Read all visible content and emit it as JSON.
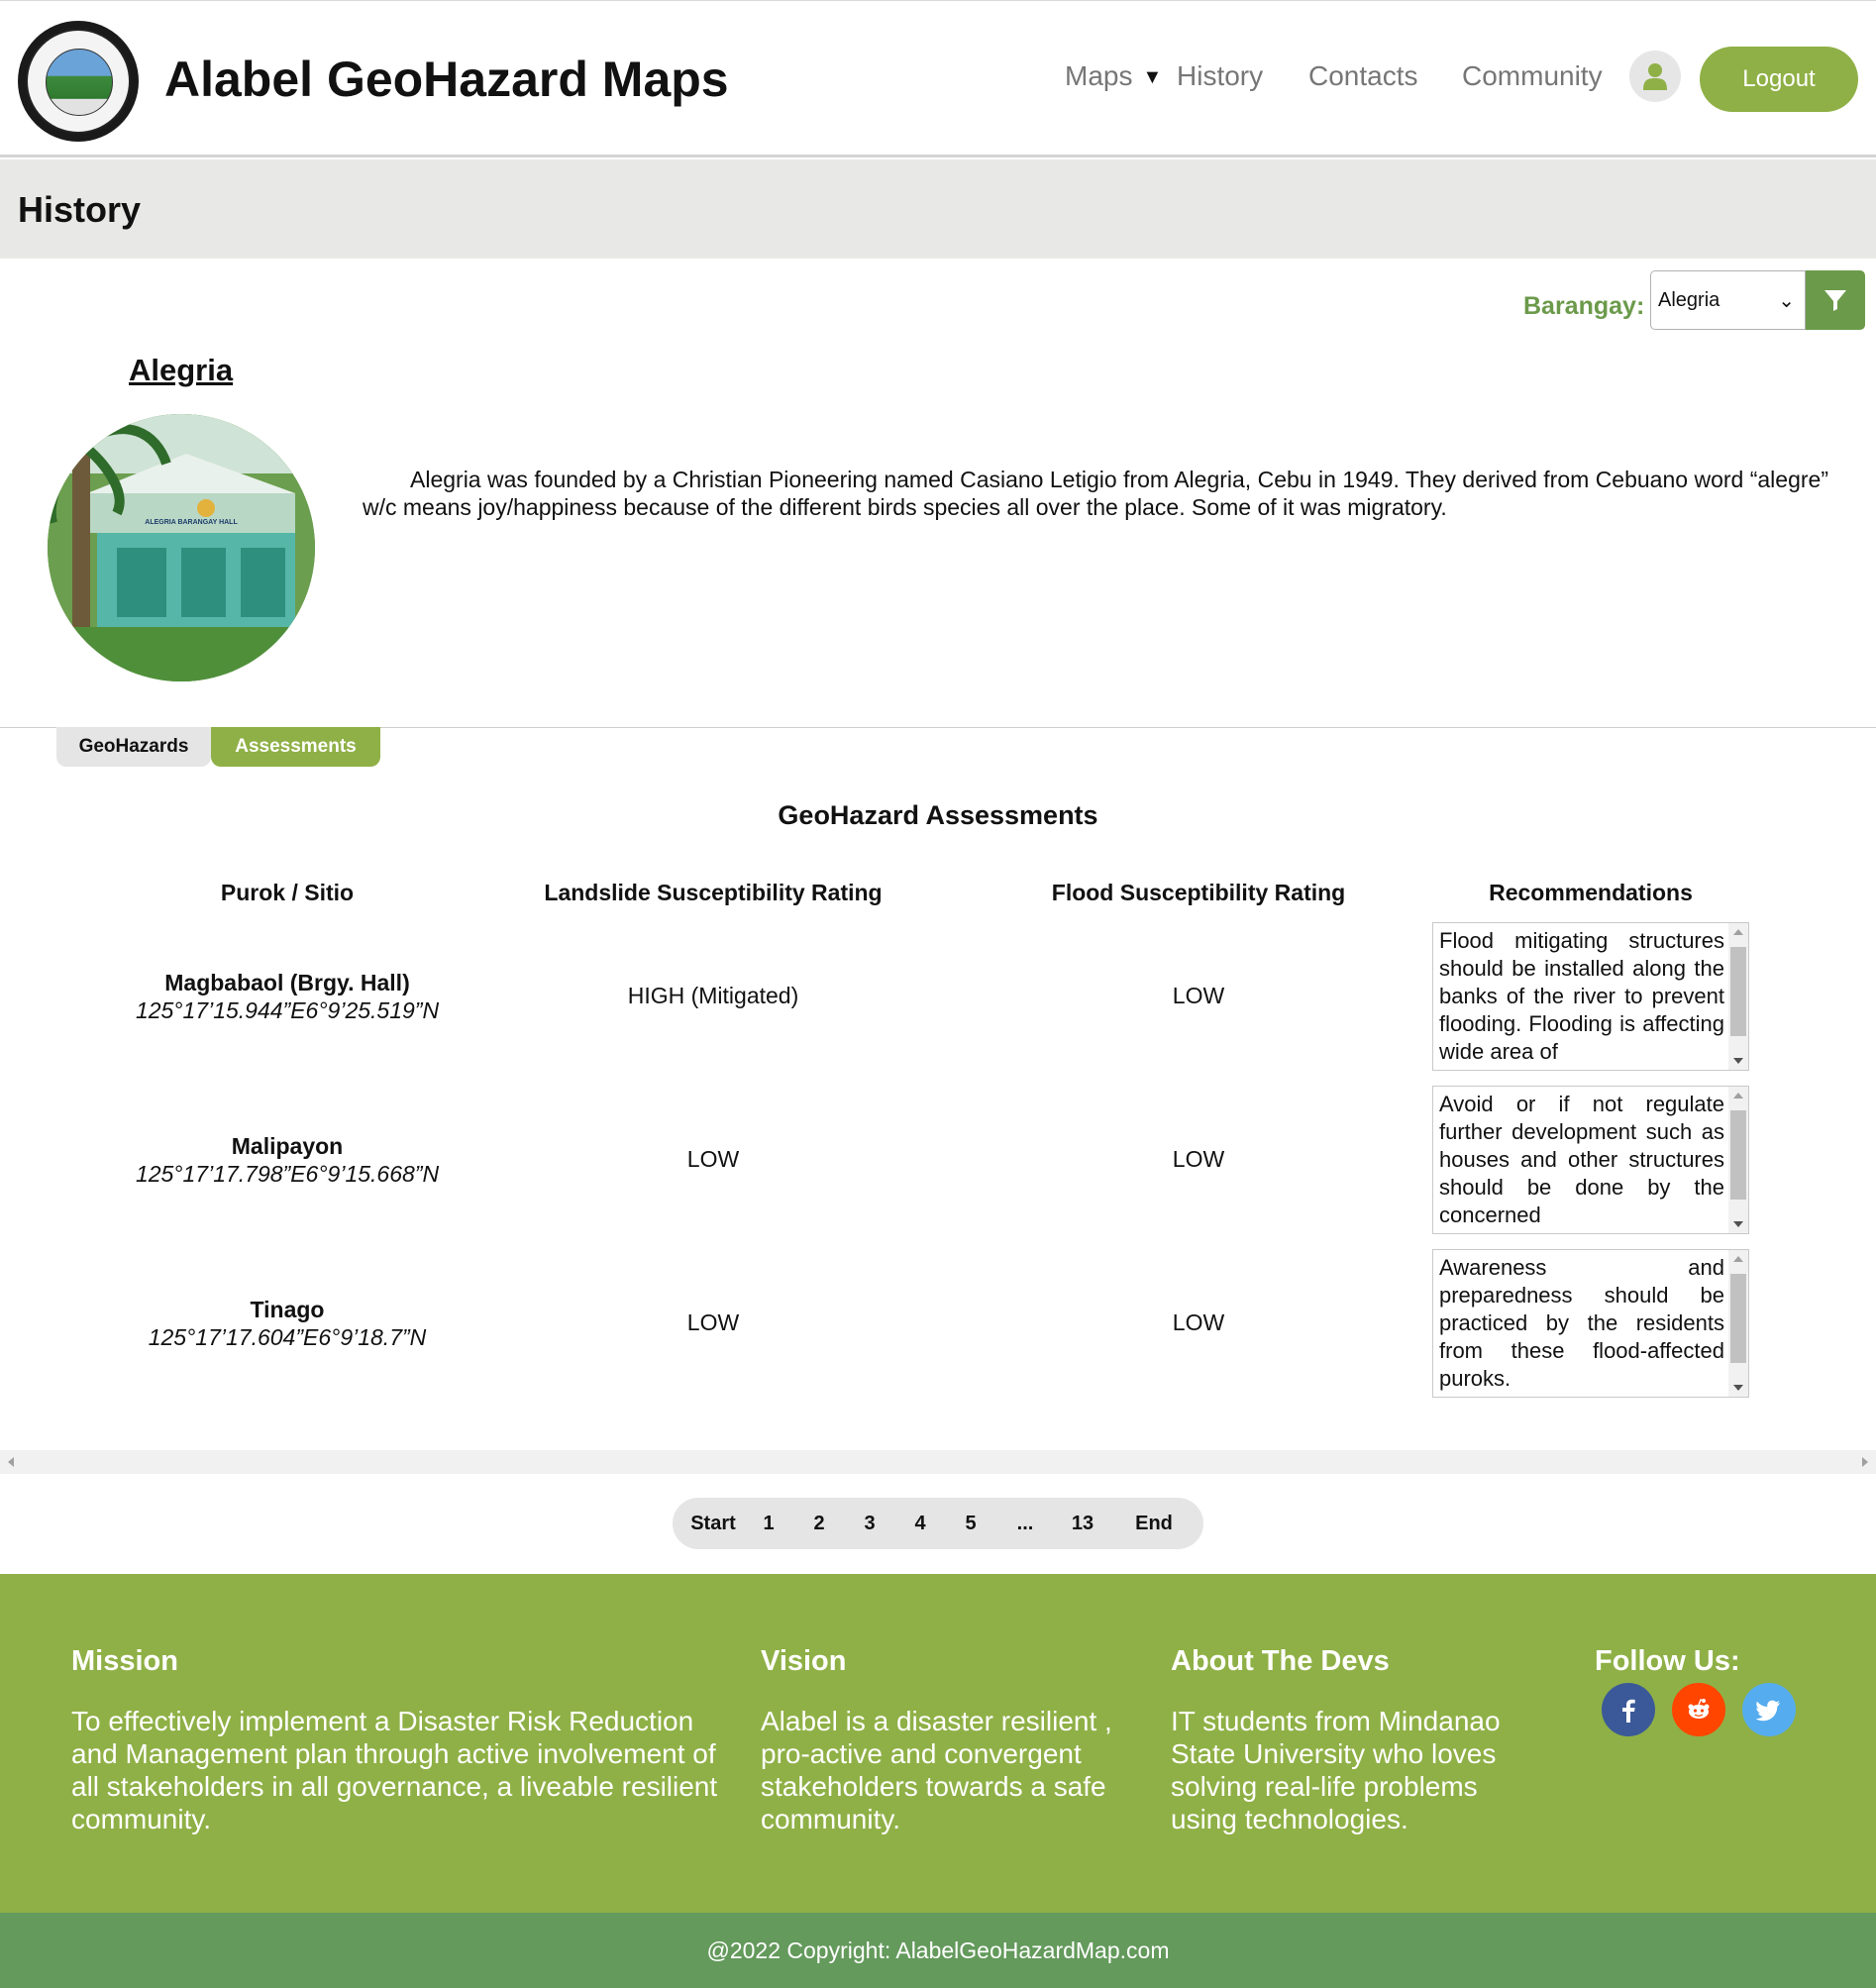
{
  "header": {
    "title": "Alabel GeoHazard Maps",
    "logo_text": "MUNICIPALITY OF ALABEL SARANGANI PROVINCE SEAL",
    "nav": {
      "maps": "Maps",
      "history": "History",
      "contacts": "Contacts",
      "community": "Community"
    },
    "logout": "Logout",
    "icons": {
      "user": "user-icon",
      "caret": "caret-down-icon"
    }
  },
  "page": {
    "title": "History"
  },
  "filter": {
    "label": "Barangay:",
    "selected": "Alegria",
    "icon": "filter-icon"
  },
  "barangay": {
    "name": "Alegria",
    "photo_caption": "ALEGRIA BARANGAY HALL",
    "description": "Alegria was founded by a Christian Pioneering named Casiano Letigio from Alegria, Cebu in 1949. They derived from Cebuano word “alegre” w/c means joy/happiness because of the different birds species all over the place. Some of it was migratory."
  },
  "tabs": {
    "geohazards": "GeoHazards",
    "assessments": "Assessments",
    "active": "Assessments"
  },
  "assessments": {
    "title": "GeoHazard Assessments",
    "columns": {
      "purok": "Purok / Sitio",
      "landslide": "Landslide Susceptibility Rating",
      "flood": "Flood Susceptibility Rating",
      "recommendations": "Recommendations"
    },
    "rows": [
      {
        "name": "Magbabaol (Brgy. Hall)",
        "coord": "125°17’15.944”E6°9’25.519”N",
        "landslide": "HIGH (Mitigated)",
        "flood": "LOW",
        "recommendation": "Flood mitigating structures should be installed along the banks of the river to prevent flooding. Flooding is affecting wide area of"
      },
      {
        "name": "Malipayon",
        "coord": "125°17’17.798”E6°9’15.668”N",
        "landslide": "LOW",
        "flood": "LOW",
        "recommendation": "Avoid or if not regulate further development such as houses and other structures should be done by the concerned"
      },
      {
        "name": "Tinago",
        "coord": "125°17’17.604”E6°9’18.7”N",
        "landslide": "LOW",
        "flood": "LOW",
        "recommendation": "Awareness and preparedness should be practiced by the residents from these flood-affected puroks."
      }
    ]
  },
  "pagination": {
    "start": "Start",
    "pages": [
      "1",
      "2",
      "3",
      "4",
      "5",
      "...",
      "13"
    ],
    "end": "End"
  },
  "footer": {
    "mission": {
      "title": "Mission",
      "text": "To effectively implement a Disaster Risk Reduction and Management plan through active involvement of all stakeholders in all governance, a liveable resilient community."
    },
    "vision": {
      "title": "Vision",
      "text": "Alabel is a disaster resilient , pro-active and convergent stakeholders towards a safe community."
    },
    "about": {
      "title": "About The Devs",
      "text": "IT students from Mindanao State University who loves solving real-life problems using technologies."
    },
    "follow": {
      "title": "Follow Us:",
      "icons": [
        "facebook-icon",
        "reddit-icon",
        "twitter-icon"
      ]
    },
    "copyright": "@2022 Copyright: AlabelGeoHazardMap.com"
  },
  "colors": {
    "accent_green": "#8fb046",
    "label_green": "#6b9a4a",
    "copyright_green": "#649a5c",
    "facebook": "#3b5998",
    "reddit": "#ff4500",
    "twitter": "#55acee"
  }
}
